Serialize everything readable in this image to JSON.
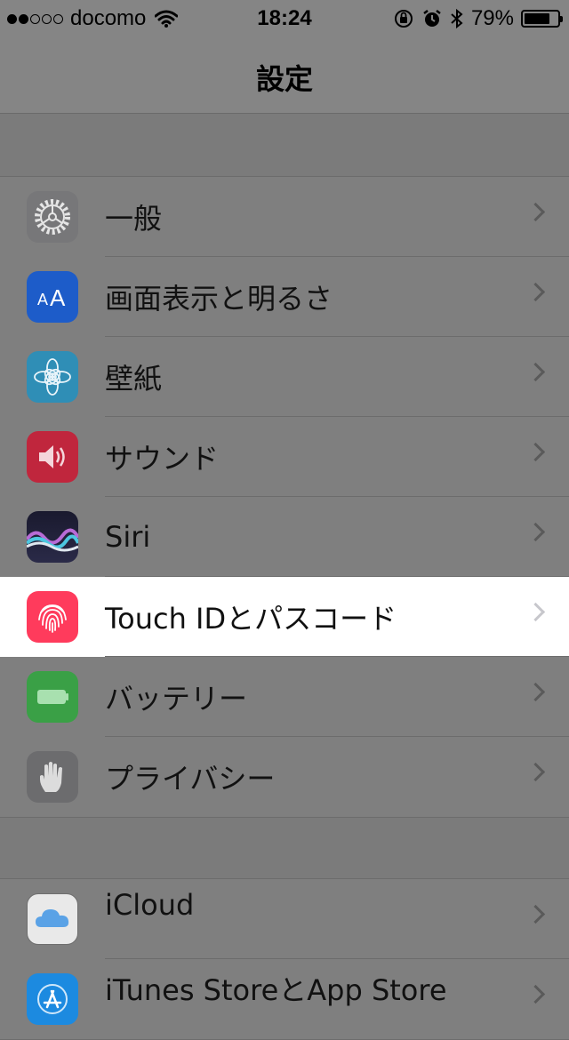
{
  "status_bar": {
    "carrier": "docomo",
    "time": "18:24",
    "battery_percent": "79%",
    "battery_level": 0.79,
    "signal_filled": 2,
    "signal_total": 5
  },
  "nav": {
    "title": "設定"
  },
  "groups": [
    {
      "items": [
        {
          "label": "一般",
          "icon": "gear-icon",
          "color": "#777779"
        },
        {
          "label": "画面表示と明るさ",
          "icon": "text-size-icon",
          "color": "#1d5cc9"
        },
        {
          "label": "壁紙",
          "icon": "flower-icon",
          "color": "#2f8eb6"
        },
        {
          "label": "サウンド",
          "icon": "speaker-icon",
          "color": "#c0263d"
        },
        {
          "label": "Siri",
          "icon": "siri-icon",
          "color": "#1f1f3a"
        },
        {
          "label": "Touch IDとパスコード",
          "icon": "fingerprint-icon",
          "color": "#ff3b5c",
          "highlighted": true
        },
        {
          "label": "バッテリー",
          "icon": "battery-icon",
          "color": "#3aa046"
        },
        {
          "label": "プライバシー",
          "icon": "hand-icon",
          "color": "#6c6c6e"
        }
      ]
    },
    {
      "items": [
        {
          "label": "iCloud",
          "icon": "cloud-icon",
          "color": "#f2f2f2"
        },
        {
          "label": "iTunes StoreとApp Store",
          "icon": "app-store-icon",
          "color": "#1c8ae0"
        }
      ]
    }
  ]
}
